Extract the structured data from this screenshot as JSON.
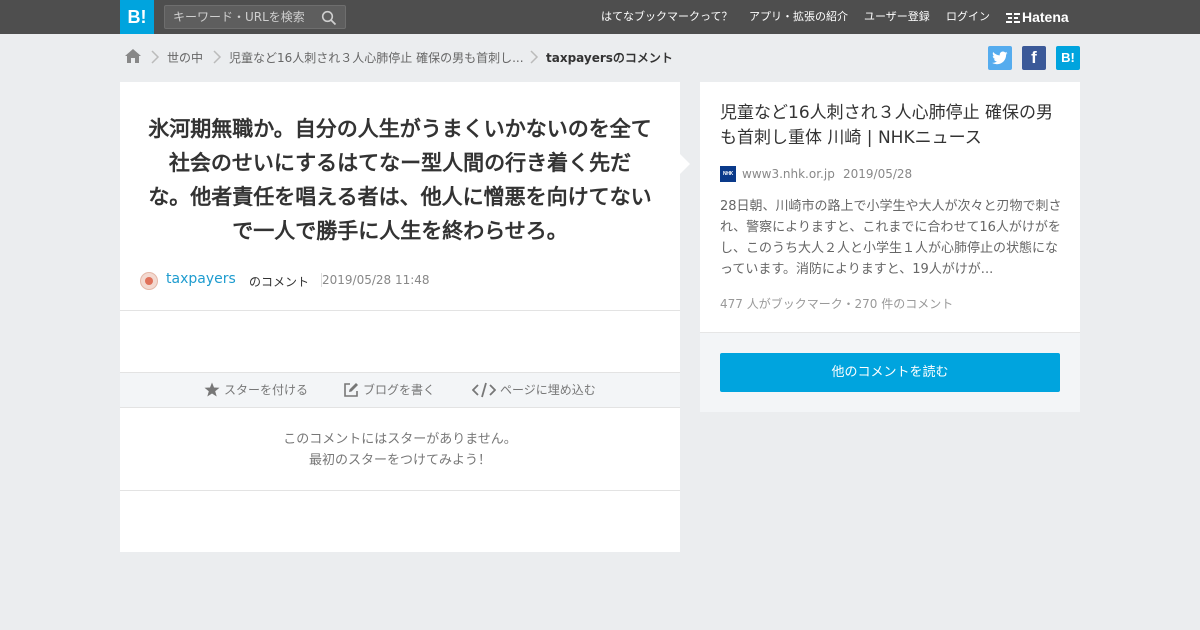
{
  "header": {
    "logo_text": "B!",
    "search_placeholder": "キーワード・URLを検索",
    "nav": [
      "はてなブックマークって？",
      "アプリ・拡張の紹介",
      "ユーザー登録",
      "ログイン"
    ],
    "brand": "Hatena",
    "bg_color": "#4e4e4e",
    "accent_color": "#00a4de"
  },
  "breadcrumb": {
    "items": [
      "世の中",
      "児童など16人刺され３人心肺停止 確保の男も首刺し...",
      "taxpayersのコメント"
    ]
  },
  "share": {
    "twitter": "twitter-icon",
    "facebook": "f",
    "hatena": "B!"
  },
  "comment": {
    "text": "氷河期無職か。自分の人生がうまくいかないのを全て社会のせいにするはてなー型人間の行き着く先だな。他者責任を唱える者は、他人に憎悪を向けてないで一人で勝手に人生を終わらせろ。",
    "user": "taxpayers",
    "suffix": "のコメント",
    "date": "2019/05/28 11:48"
  },
  "actions": {
    "star": "スターを付ける",
    "blog": "ブログを書く",
    "embed": "ページに埋め込む"
  },
  "stars": {
    "line1": "このコメントにはスターがありません。",
    "line2": "最初のスターをつけてみよう！"
  },
  "entry": {
    "title": "児童など16人刺され３人心肺停止 確保の男も首刺し重体 川崎 | NHKニュース",
    "favicon_text": "NHK",
    "domain": "www3.nhk.or.jp",
    "date": "2019/05/28",
    "summary": "28日朝、川崎市の路上で小学生や大人が次々と刃物で刺され、警察によりますと、これまでに合わせて16人がけがをし、このうち大人２人と小学生１人が心肺停止の状態になっています。消防によりますと、19人がけが...",
    "counts": "477 人がブックマーク・270 件のコメント",
    "read_button": "他のコメントを読む"
  }
}
